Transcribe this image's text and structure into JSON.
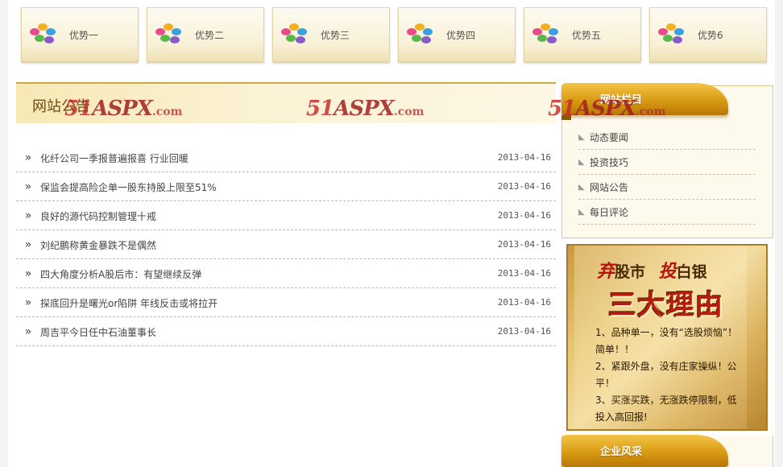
{
  "advantages": [
    {
      "label": "优势一"
    },
    {
      "label": "优势二"
    },
    {
      "label": "优势三"
    },
    {
      "label": "优势四"
    },
    {
      "label": "优势五"
    },
    {
      "label": "优势6"
    }
  ],
  "notice": {
    "title": "网站公告",
    "items": [
      {
        "title": "化纤公司一季报普遍报喜 行业回暖",
        "date": "2013-04-16"
      },
      {
        "title": "保监会提高险企单一股东持股上限至51%",
        "date": "2013-04-16"
      },
      {
        "title": "良好的源代码控制管理十戒",
        "date": "2013-04-16"
      },
      {
        "title": "刘纪鹏称黄金暴跌不是偶然",
        "date": "2013-04-16"
      },
      {
        "title": "四大角度分析A股后市：有望继续反弹",
        "date": "2013-04-16"
      },
      {
        "title": "探底回升是曙光or陷阱 年线反击或将拉开",
        "date": "2013-04-16"
      },
      {
        "title": "周吉平今日任中石油董事长",
        "date": "2013-04-16"
      }
    ]
  },
  "watermark": {
    "brand": "51",
    "word": "ASPX",
    "suffix": ".com"
  },
  "sidebar": {
    "title": "网站栏目",
    "items": [
      {
        "label": "动态要闻"
      },
      {
        "label": "投资技巧"
      },
      {
        "label": "网站公告"
      },
      {
        "label": "每日评论"
      }
    ]
  },
  "promo": {
    "quit_char": "弃",
    "quit_word": "股市",
    "invest_char": "投",
    "invest_word": "白银",
    "headline": "三大理由",
    "reasons": [
      "1、品种单一，没有“选股烦恼”！简单！！",
      "2、紧跟外盘，没有庄家操纵！公平！",
      "3、买涨买跌，无涨跌停限制，低投入高回报!"
    ]
  },
  "gallery": {
    "title": "企业风采"
  },
  "colors": {
    "gold": "#d99a12",
    "accent_red": "#b81b10",
    "panel_bg": "#fdf9ec"
  }
}
